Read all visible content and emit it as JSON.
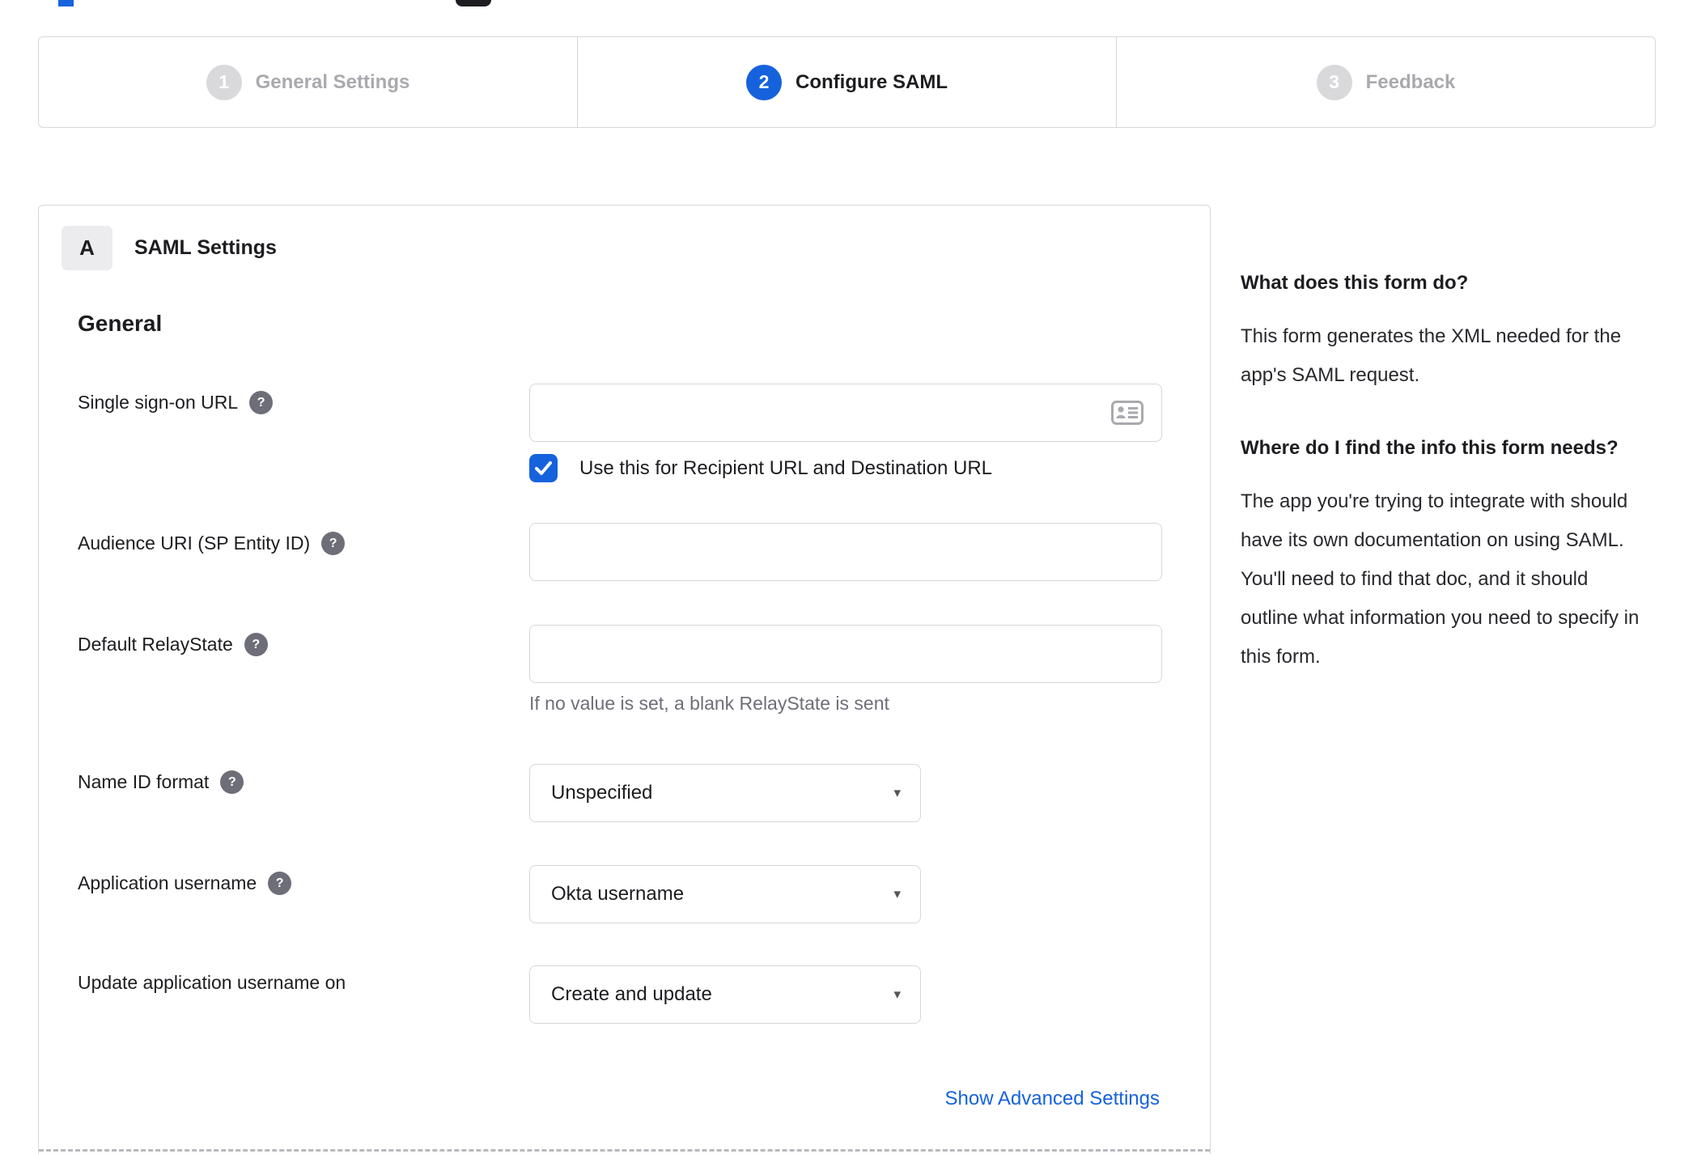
{
  "colors": {
    "accent_blue": "#1662dd",
    "inactive_gray": "#a9a9ae",
    "border_gray": "#d7d7da",
    "help_icon_gray": "#6e6e78",
    "text_dark": "#1d1d21"
  },
  "stepper": {
    "steps": [
      {
        "number": "1",
        "label": "General Settings",
        "state": "inactive"
      },
      {
        "number": "2",
        "label": "Configure SAML",
        "state": "active"
      },
      {
        "number": "3",
        "label": "Feedback",
        "state": "inactive"
      }
    ]
  },
  "panel": {
    "badge": "A",
    "title": "SAML Settings",
    "section_title": "General",
    "fields": {
      "sso": {
        "label": "Single sign-on URL",
        "value": "",
        "checkbox_label": "Use this for Recipient URL and Destination URL",
        "checked": true
      },
      "audience": {
        "label": "Audience URI (SP Entity ID)",
        "value": ""
      },
      "relay": {
        "label": "Default RelayState",
        "value": "",
        "hint": "If no value is set, a blank RelayState is sent"
      },
      "name_id": {
        "label": "Name ID format",
        "value": "Unspecified"
      },
      "app_username": {
        "label": "Application username",
        "value": "Okta username"
      },
      "update_username": {
        "label": "Update application username on",
        "value": "Create and update"
      }
    },
    "advanced_link": "Show Advanced Settings"
  },
  "sidebar": {
    "q1": "What does this form do?",
    "a1": "This form generates the XML needed for the app's SAML request.",
    "q2": "Where do I find the info this form needs?",
    "a2": "The app you're trying to integrate with should have its own documentation on using SAML. You'll need to find that doc, and it should outline what information you need to specify in this form."
  }
}
